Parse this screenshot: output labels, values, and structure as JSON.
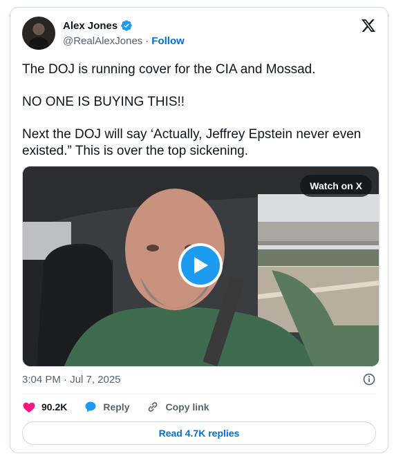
{
  "author": {
    "name": "Alex Jones",
    "handle": "@RealAlexJones",
    "separator": "·",
    "follow_label": "Follow"
  },
  "tweet": {
    "lines": [
      "The DOJ is running cover for the CIA and Mossad.",
      "NO ONE IS BUYING THIS!!",
      "Next the DOJ will say ‘Actually, Jeffrey Epstein never even existed.” This is over the top sickening."
    ]
  },
  "media": {
    "watch_label": "Watch on X"
  },
  "meta": {
    "timestamp": "3:04 PM · Jul 7, 2025"
  },
  "actions": {
    "likes": "90.2K",
    "reply_label": "Reply",
    "copy_link_label": "Copy link"
  },
  "read_replies_label": "Read 4.7K replies",
  "colors": {
    "accent": "#1d9bf0",
    "link": "#006fd6",
    "like": "#f91880",
    "secondary_text": "#536471"
  }
}
